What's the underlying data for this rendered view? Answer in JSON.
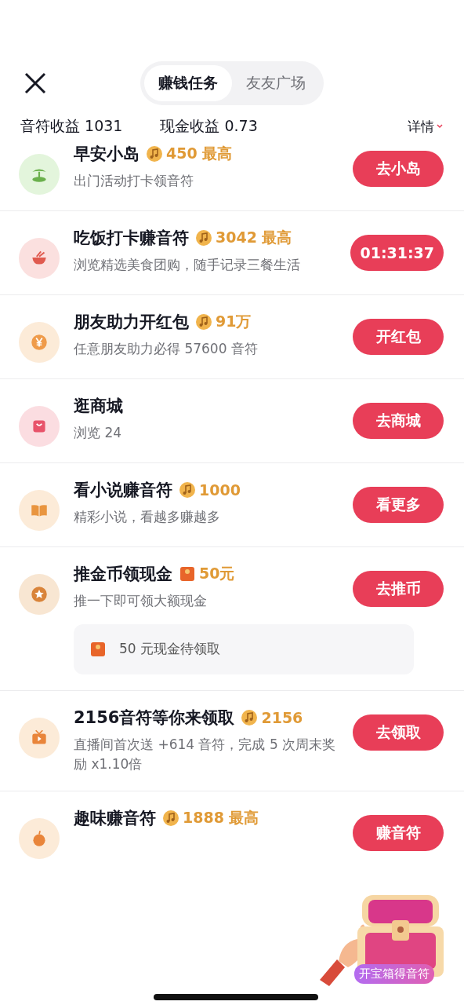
{
  "tabs": [
    {
      "label": "赚钱任务",
      "selected": true
    },
    {
      "label": "友友广场",
      "selected": false
    }
  ],
  "earnings": [
    {
      "label": "音符收益",
      "value": "1031"
    },
    {
      "label": "现金收益",
      "value": "0.73"
    }
  ],
  "details_link": "详情",
  "tasks": [
    {
      "kind": "island",
      "title": "早安小岛",
      "reward": {
        "kind": "coin",
        "amount": "450 最高"
      },
      "description": "出门活动打卡领音符",
      "button": "去小岛"
    },
    {
      "kind": "bowl",
      "title": "吃饭打卡赚音符",
      "reward": {
        "kind": "coin",
        "amount": "3042 最高"
      },
      "description": "浏览精选美食团购，随手记录三餐生活",
      "button": "01:31:37"
    },
    {
      "kind": "yen",
      "title": "朋友助力开红包",
      "reward": {
        "kind": "coin",
        "amount": "91万"
      },
      "description": "任意朋友助力必得 57600 音符",
      "button": "开红包"
    },
    {
      "kind": "bag",
      "title": "逛商城",
      "description": "浏览 24",
      "button": "去商城"
    },
    {
      "kind": "book",
      "title": "看小说赚音符",
      "reward": {
        "kind": "coin",
        "amount": "1000"
      },
      "description": "精彩小说，看越多赚越多",
      "button": "看更多"
    },
    {
      "kind": "star",
      "title": "推金币领现金",
      "reward": {
        "kind": "cash",
        "amount": "50元"
      },
      "description": "推一下即可领大额现金",
      "button": "去推币",
      "note": {
        "kind": "cash",
        "text": "50 元现金待领取"
      }
    },
    {
      "kind": "tv",
      "title": "2156音符等你来领取",
      "reward": {
        "kind": "coin",
        "amount": "2156"
      },
      "description": "直播间首次送 +614 音符，完成 5 次周末奖励 x1.10倍",
      "button": "去领取"
    },
    {
      "kind": "fruit",
      "title": "趣味赚音符",
      "reward": {
        "kind": "coin",
        "amount": "1888 最高"
      },
      "button": "赚音符"
    }
  ],
  "treasure": {
    "label": "开宝箱得音符"
  }
}
